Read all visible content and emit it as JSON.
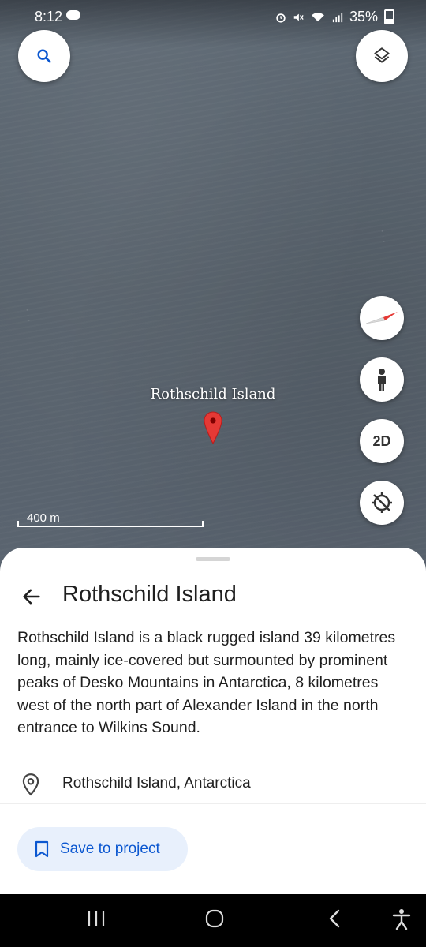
{
  "status_bar": {
    "time": "8:12",
    "battery": "35%",
    "icons": [
      "cloud-sync-icon",
      "alarm-icon",
      "mute-icon",
      "wifi-icon",
      "signal-icon",
      "battery-icon"
    ]
  },
  "map": {
    "place_label": "Rothschild Island",
    "scale_label": "400 m",
    "view_mode_label": "2D",
    "controls": [
      "search-icon",
      "layers-icon",
      "compass-icon",
      "pegman-icon",
      "location-icon"
    ]
  },
  "sheet": {
    "title": "Rothschild Island",
    "description": "Rothschild Island is a black rugged island 39 kilometres long, mainly ice-covered but surmounted by prominent peaks of Desko Mountains in Antarctica, 8 kilometres west of the north part of Alexander Island in the north entrance to Wilkins Sound.",
    "location": "Rothschild Island, Antarctica",
    "save_button": "Save to project"
  },
  "colors": {
    "accent": "#0b57d0",
    "pin": "#e53935",
    "compass_red": "#e53935"
  },
  "nav_bar": [
    "recents-icon",
    "home-icon",
    "back-icon",
    "accessibility-icon"
  ]
}
